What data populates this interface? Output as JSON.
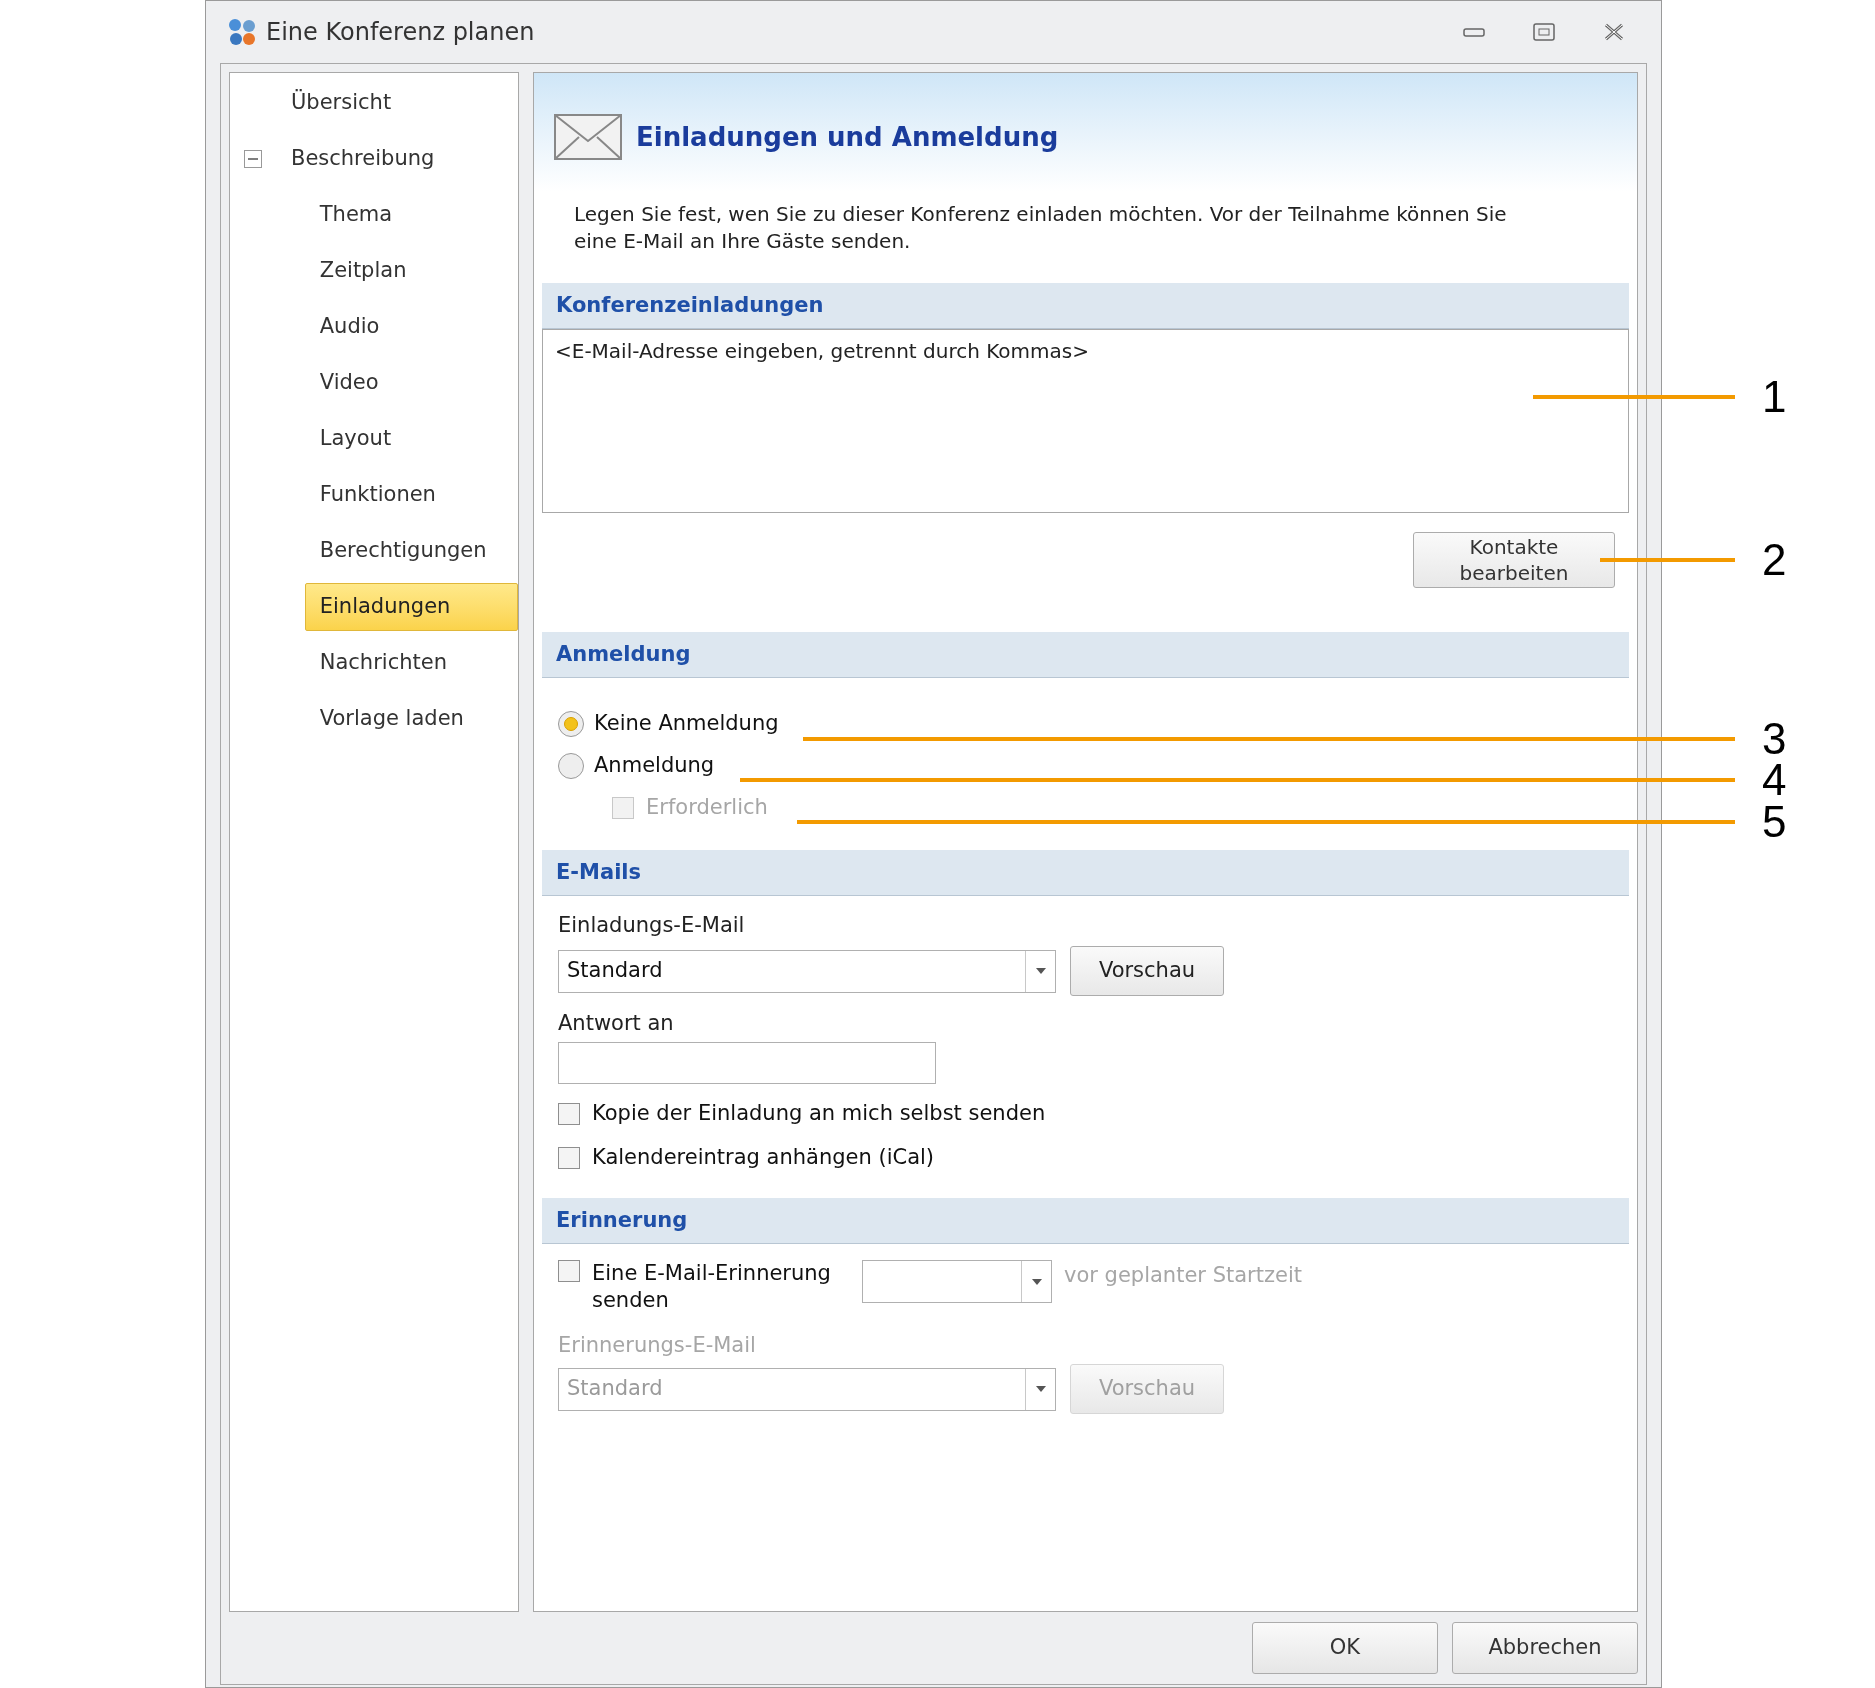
{
  "window": {
    "title": "Eine Konferenz planen"
  },
  "sidebar": {
    "items": [
      {
        "label": "Übersicht",
        "selected": false
      },
      {
        "label": "Beschreibung",
        "selected": false,
        "expanded": true,
        "children": [
          {
            "label": "Thema",
            "selected": false
          },
          {
            "label": "Zeitplan",
            "selected": false
          },
          {
            "label": "Audio",
            "selected": false
          },
          {
            "label": "Video",
            "selected": false
          },
          {
            "label": "Layout",
            "selected": false
          },
          {
            "label": "Funktionen",
            "selected": false
          },
          {
            "label": "Berechtigungen",
            "selected": false
          },
          {
            "label": "Einladungen",
            "selected": true
          },
          {
            "label": "Nachrichten",
            "selected": false
          },
          {
            "label": "Vorlage laden",
            "selected": false
          }
        ]
      }
    ]
  },
  "content": {
    "title": "Einladungen und Anmeldung",
    "description": "Legen Sie fest, wen Sie zu dieser Konferenz einladen möchten.  Vor der Teilnahme können Sie eine E-Mail an Ihre Gäste senden.",
    "invitations": {
      "heading": "Konferenzeinladungen",
      "placeholder": "<E-Mail-Adresse eingeben, getrennt durch Kommas>",
      "button": "Kontakte bearbeiten"
    },
    "registration": {
      "heading": "Anmeldung",
      "options": [
        {
          "label": "Keine Anmeldung",
          "selected": true
        },
        {
          "label": "Anmeldung",
          "selected": false
        }
      ],
      "required": {
        "label": "Erforderlich",
        "checked": false,
        "disabled": true
      }
    },
    "emails": {
      "heading": "E-Mails",
      "invite_label": "Einladungs-E-Mail",
      "invite_value": "Standard",
      "preview": "Vorschau",
      "reply_label": "Antwort an",
      "checkboxes": [
        {
          "label": "Kopie der Einladung an mich selbst senden",
          "checked": false
        },
        {
          "label": "Kalendereintrag anhängen (iCal)",
          "checked": false
        }
      ]
    },
    "reminder": {
      "heading": "Erinnerung",
      "send": {
        "label": "Eine E-Mail-Erinnerung senden",
        "checked": false
      },
      "suffix": "vor geplanter Startzeit",
      "suffix_disabled": true,
      "mail_label": "Erinnerungs-E-Mail",
      "mail_value": "Standard",
      "preview": "Vorschau",
      "disabled": true
    }
  },
  "buttons": [
    "OK",
    "Abbrechen"
  ],
  "callouts": [
    "1",
    "2",
    "3",
    "4",
    "5"
  ]
}
